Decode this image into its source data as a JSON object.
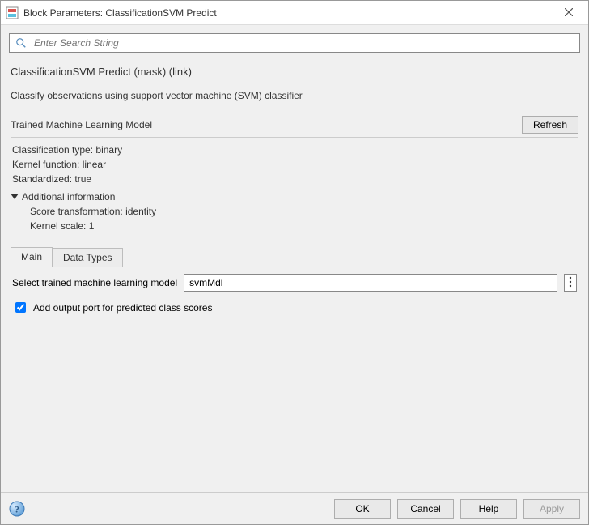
{
  "window": {
    "title": "Block Parameters: ClassificationSVM Predict"
  },
  "search": {
    "placeholder": "Enter Search String"
  },
  "block_desc": {
    "header": "ClassificationSVM Predict (mask) (link)",
    "description": "Classify observations using support vector machine (SVM) classifier"
  },
  "trained_model": {
    "section_title": "Trained Machine Learning Model",
    "refresh_label": "Refresh",
    "classification_type": {
      "label": "Classification type:",
      "value": "binary"
    },
    "kernel_function": {
      "label": "Kernel function:",
      "value": "linear"
    },
    "standardized": {
      "label": "Standardized:",
      "value": "true"
    },
    "additional_info_label": "Additional information",
    "score_transformation": {
      "label": "Score transformation:",
      "value": "identity"
    },
    "kernel_scale": {
      "label": "Kernel scale:",
      "value": "1"
    }
  },
  "tabs": {
    "main_label": "Main",
    "data_types_label": "Data Types"
  },
  "main_tab": {
    "select_model_label": "Select trained machine learning model",
    "model_value": "svmMdl",
    "output_port_label": "Add output port for predicted class scores",
    "output_port_checked": true
  },
  "footer": {
    "ok_label": "OK",
    "cancel_label": "Cancel",
    "help_label": "Help",
    "apply_label": "Apply"
  }
}
